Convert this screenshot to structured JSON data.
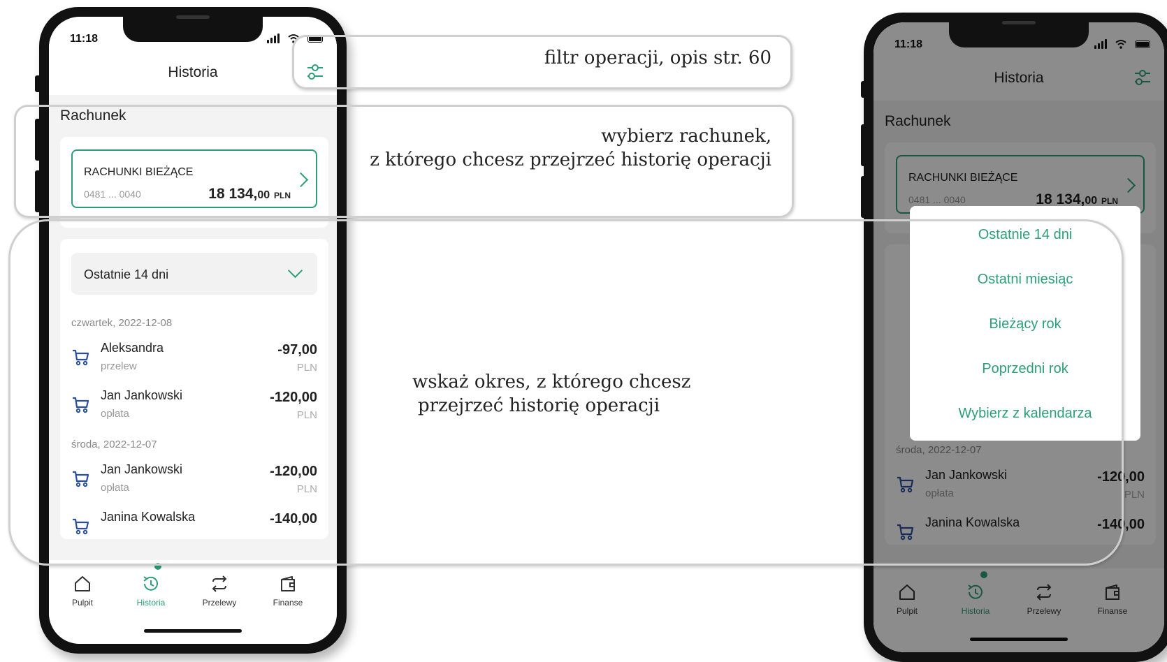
{
  "left_phone": {
    "status_time": "11:18",
    "title": "Historia",
    "account_section": "Rachunek",
    "account": {
      "name": "RACHUNKI BIEŻĄCE",
      "number": "0481 ... 0040",
      "balance_main": "18 134,",
      "balance_dec": "00",
      "currency": "PLN"
    },
    "period": "Ostatnie 14 dni",
    "groups": [
      {
        "date": "czwartek, 2022-12-08",
        "transactions": [
          {
            "name": "Aleksandra",
            "type": "przelew",
            "amount": "-97,00",
            "currency": "PLN"
          },
          {
            "name": "Jan Jankowski",
            "type": "opłata",
            "amount": "-120,00",
            "currency": "PLN"
          }
        ]
      },
      {
        "date": "środa, 2022-12-07",
        "transactions": [
          {
            "name": "Jan Jankowski",
            "type": "opłata",
            "amount": "-120,00",
            "currency": "PLN"
          },
          {
            "name": "Janina Kowalska",
            "type": "",
            "amount": "-140,00",
            "currency": ""
          }
        ]
      }
    ],
    "nav": [
      {
        "label": "Pulpit",
        "icon": "home-icon"
      },
      {
        "label": "Historia",
        "icon": "history-icon"
      },
      {
        "label": "Przelewy",
        "icon": "transfer-icon"
      },
      {
        "label": "Finanse",
        "icon": "finance-icon"
      }
    ]
  },
  "right_phone": {
    "status_time": "11:18",
    "title": "Historia",
    "account_section": "Rachunek",
    "account": {
      "name": "RACHUNKI BIEŻĄCE",
      "number": "0481 ... 0040",
      "balance_main": "18 134,",
      "balance_dec": "00",
      "currency": "PLN"
    },
    "period_options": [
      "Ostatnie 14 dni",
      "Ostatni miesiąc",
      "Bieżący rok",
      "Poprzedni rok",
      "Wybierz z kalendarza"
    ],
    "group": {
      "date": "środa, 2022-12-07",
      "transactions": [
        {
          "name": "Jan Jankowski",
          "type": "opłata",
          "amount": "-120,00",
          "currency": "PLN"
        },
        {
          "name": "Janina Kowalska",
          "type": "",
          "amount": "-140,00",
          "currency": ""
        }
      ]
    },
    "nav": [
      {
        "label": "Pulpit",
        "icon": "home-icon"
      },
      {
        "label": "Historia",
        "icon": "history-icon"
      },
      {
        "label": "Przelewy",
        "icon": "transfer-icon"
      },
      {
        "label": "Finanse",
        "icon": "finance-icon"
      }
    ]
  },
  "callouts": {
    "filter": "filtr operacji, opis str. 60",
    "account_line1": "wybierz rachunek,",
    "account_line2": "z którego chcesz przejrzeć historię operacji",
    "period_line1": "wskaż okres, z którego chcesz",
    "period_line2": "przejrzeć historię operacji"
  },
  "colors": {
    "accent": "#2d9f77",
    "icon_blue": "#2b4fa0",
    "frame": "#111111",
    "callout_border": "#cfcfcf"
  }
}
